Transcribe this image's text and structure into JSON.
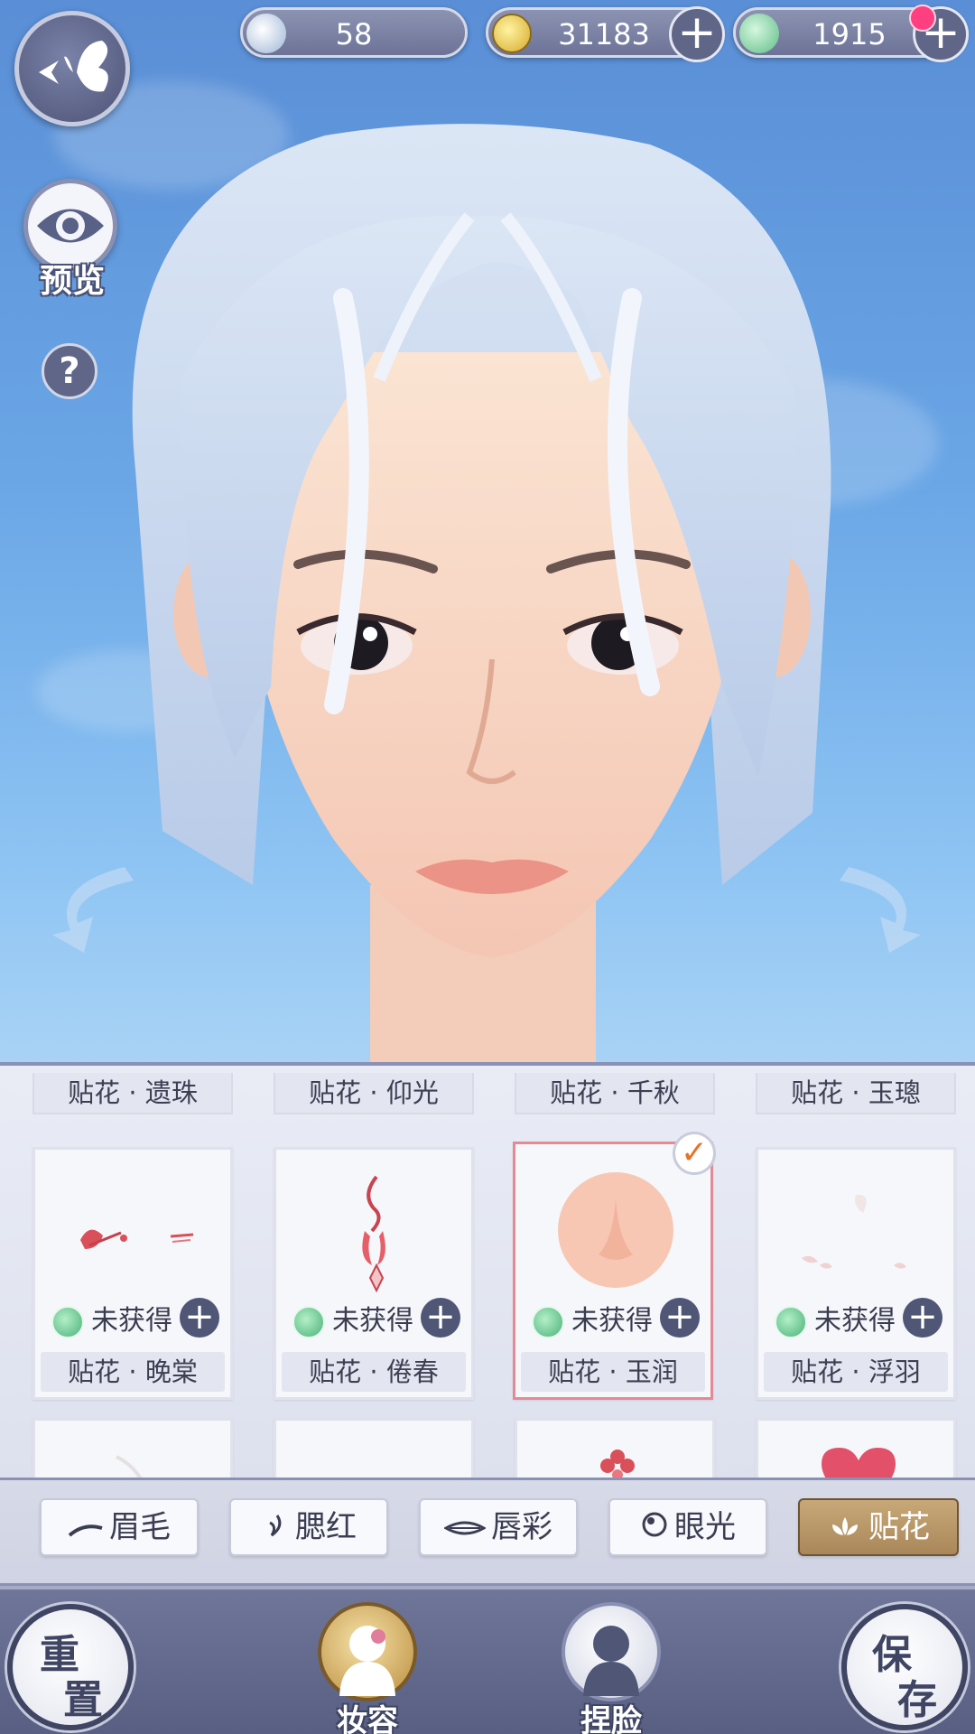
{
  "currencies": [
    {
      "icon": "wave-token-icon",
      "value": "58",
      "has_plus": false
    },
    {
      "icon": "copper-coin-icon",
      "value": "31183",
      "has_plus": true
    },
    {
      "icon": "jade-icon",
      "value": "1915",
      "has_plus": true,
      "has_notification": true
    }
  ],
  "tools": {
    "preview_label": "预览",
    "help_label": "?"
  },
  "top_row_labels": [
    "贴花 · 遗珠",
    "贴花 · 仰光",
    "贴花 · 千秋",
    "贴花 · 玉璁"
  ],
  "cards": [
    {
      "name": "贴花 · 晚棠",
      "status": "未获得",
      "selected": false,
      "art": "red-floral-decal"
    },
    {
      "name": "贴花 · 倦春",
      "status": "未获得",
      "selected": false,
      "art": "red-pendant-decal"
    },
    {
      "name": "贴花 · 玉润",
      "status": "未获得",
      "selected": true,
      "art": "nose-decal"
    },
    {
      "name": "贴花 · 浮羽",
      "status": "未获得",
      "selected": false,
      "art": "feather-decal"
    }
  ],
  "tabs": [
    {
      "label": "眉毛",
      "icon": "eyebrow-icon",
      "active": false
    },
    {
      "label": "腮红",
      "icon": "blush-icon",
      "active": false
    },
    {
      "label": "唇彩",
      "icon": "lips-icon",
      "active": false
    },
    {
      "label": "眼光",
      "icon": "eye-shine-icon",
      "active": false
    },
    {
      "label": "贴花",
      "icon": "lotus-icon",
      "active": true
    }
  ],
  "bottom": {
    "reset": [
      "重",
      "置"
    ],
    "save": [
      "保",
      "存"
    ],
    "makeup_label": "妆容",
    "face_label": "捏脸"
  },
  "colors": {
    "panel_accent": "#8b91b6",
    "selected_border": "#e58a94",
    "active_tab": "#b8976a",
    "notification": "#ff3f7f"
  }
}
